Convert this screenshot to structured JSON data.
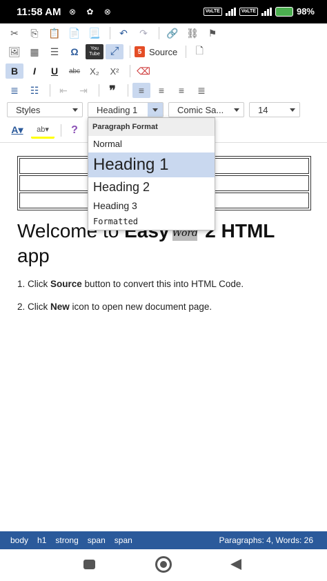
{
  "status": {
    "time": "11:58 AM",
    "battery": "98%",
    "volte": "VoLTE"
  },
  "toolbar": {
    "source_label": "Source",
    "styles_label": "Styles",
    "format_label": "Heading 1",
    "font_label": "Comic Sa...",
    "size_label": "14",
    "help_symbol": "?",
    "quote_symbol": "❞",
    "omega_symbol": "Ω",
    "youtube_label": "You Tube",
    "html5_label": "5"
  },
  "dropdown": {
    "header": "Paragraph Format",
    "items": [
      {
        "label": "Normal"
      },
      {
        "label": "Heading 1",
        "selected": true
      },
      {
        "label": "Heading 2"
      },
      {
        "label": "Heading 3"
      },
      {
        "label": "Formatted"
      }
    ]
  },
  "content": {
    "heading_before": "Welcome to ",
    "heading_bold": "Easy",
    "heading_image_text": "Word",
    "heading_after_bold": " 2 HTML",
    "heading_line2": "app",
    "p1_before": "1. Click ",
    "p1_bold": "Source",
    "p1_after": " button to convert this into HTML Code.",
    "p2_before": "2. Click ",
    "p2_bold": "New",
    "p2_after": " icon to open new document page."
  },
  "pathbar": {
    "crumbs": [
      "body",
      "h1",
      "strong",
      "span",
      "span"
    ],
    "count": "Paragraphs: 4, Words: 26"
  },
  "colors": {
    "accent": "#2b5a9b",
    "highlight": "#c9d8ef"
  }
}
